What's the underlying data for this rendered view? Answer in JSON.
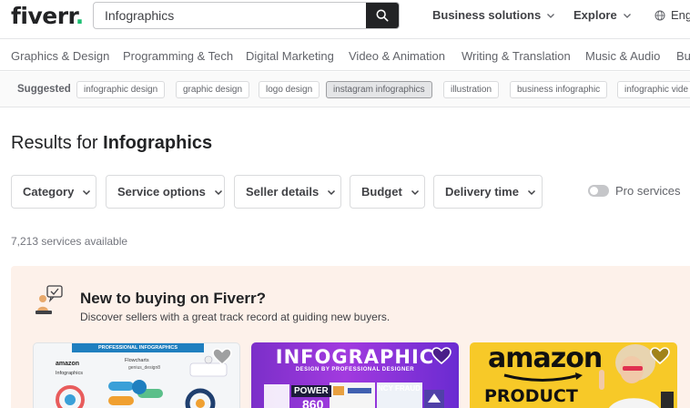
{
  "header": {
    "logo": "fiverr",
    "logo_dot": ".",
    "search_value": "Infographics",
    "nav": {
      "business": "Business solutions",
      "explore": "Explore",
      "language": "Eng"
    }
  },
  "categories": [
    "Graphics & Design",
    "Programming & Tech",
    "Digital Marketing",
    "Video & Animation",
    "Writing & Translation",
    "Music & Audio",
    "Bu"
  ],
  "suggested": {
    "label": "Suggested",
    "chips": [
      "infographic design",
      "graphic design",
      "logo design",
      "instagram infographics",
      "illustration",
      "business infographic",
      "infographic vide"
    ],
    "active_index": 3
  },
  "results": {
    "prefix": "Results for",
    "query": "Infographics",
    "count": "7,213 services available"
  },
  "filters": [
    "Category",
    "Service options",
    "Seller details",
    "Budget",
    "Delivery time"
  ],
  "pro_services": "Pro services",
  "promo": {
    "title": "New to buying on Fiverr?",
    "subtitle": "Discover sellers with a great track record at guiding new buyers."
  },
  "cards": {
    "card1": {
      "banner": "PROFESSIONAL INFOGRAPHICS",
      "amazon": "amazon",
      "sub": "Infographics",
      "flow": "Flowcharts",
      "brand": "genius_design8"
    },
    "card2": {
      "title": "INFOGRAPHIC",
      "sub": "DESIGN BY PROFESSIONAL DESIGNER",
      "power": "POWER",
      "num": "860",
      "fraud": "NCY FRAUD"
    },
    "card3": {
      "amazon": "amazon",
      "product": "PRODUCT"
    }
  },
  "colors": {
    "brand_green": "#1dbf73",
    "promo_bg": "#fdf1ea",
    "text_dark": "#222325"
  }
}
